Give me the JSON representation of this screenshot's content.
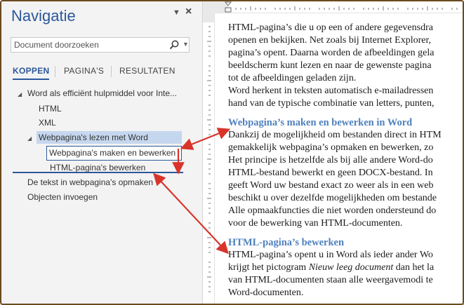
{
  "nav": {
    "title": "Navigatie",
    "menu_icon": "chevron-down-icon",
    "close_label": "×",
    "search": {
      "placeholder": "Document doorzoeken",
      "icon": "search-icon"
    },
    "tabs": [
      {
        "label": "KOPPEN",
        "active": true
      },
      {
        "label": "PAGINA'S",
        "active": false
      },
      {
        "label": "RESULTATEN",
        "active": false
      }
    ],
    "tree": [
      {
        "label": "Word als efficiënt hulpmiddel voor Inte...",
        "expanded": true
      },
      {
        "label": "HTML"
      },
      {
        "label": "XML"
      },
      {
        "label": "Webpagina's lezen met Word",
        "expanded": true,
        "selected": true
      },
      {
        "label": "Webpagina's maken en bewerken"
      },
      {
        "label": "HTML-pagina's bewerken"
      },
      {
        "label": "De tekst in webpagina's opmaken"
      },
      {
        "label": "Objecten invoegen"
      }
    ]
  },
  "document": {
    "para1": [
      "HTML-pagina’s die u op een of andere gegevensdra",
      "openen en bekijken. Net zoals bij Internet Explorer,",
      "pagina’s opent. Daarna worden de afbeeldingen gela",
      "beeldscherm kunt lezen en naar de gewenste pagina",
      "tot de afbeeldingen geladen zijn.",
      "Word herkent in teksten automatisch e-mailadressen",
      "hand van de typische combinatie van letters, punten,"
    ],
    "heading1": "Webpagina’s maken en bewerken in Word",
    "para2": [
      "Dankzij de mogelijkheid om bestanden direct in HTM",
      "gemakkelijk webpagina’s opmaken en bewerken, zo",
      "Het principe is hetzelfde als bij alle andere Word-do",
      "HTML-bestand bewerkt en geen DOCX-bestand. In",
      "geeft Word uw bestand exact zo weer als in een web",
      "beschikt u over dezelfde mogelijkheden om bestande",
      "Alle opmaakfuncties die niet worden ondersteund do",
      "voor de bewerking van HTML-documenten."
    ],
    "heading2": "HTML-pagina’s bewerken",
    "para3": {
      "line1": "HTML-pagina’s opent u in Word als ieder ander Wo",
      "line2_before": "krijgt het pictogram ",
      "line2_italic": "Nieuw leeg document",
      "line2_after": " dan het la",
      "line3": "van HTML-documenten staan alle weergavemodi te",
      "line4": "Word-documenten."
    }
  },
  "colors": {
    "accent": "#2b579a",
    "heading": "#4f81bd",
    "arrow": "#d9342b",
    "frame": "#6b4a1e"
  }
}
